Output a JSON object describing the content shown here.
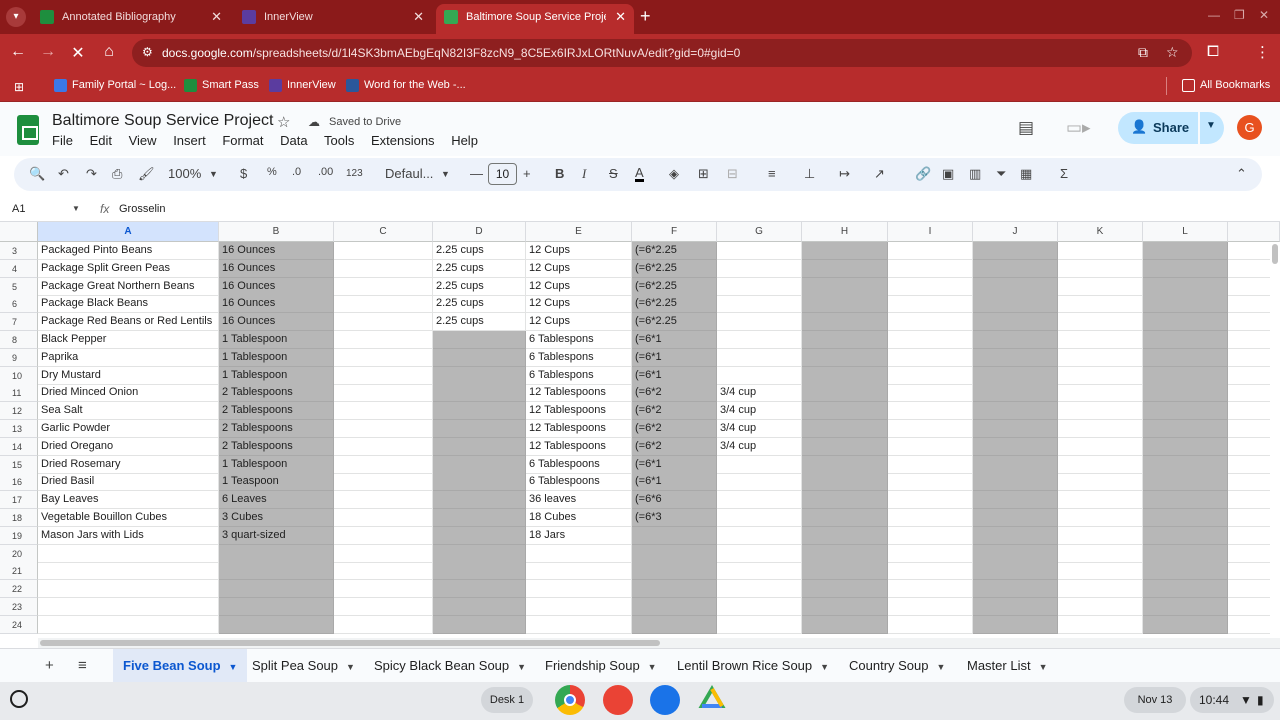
{
  "browser": {
    "tabs": [
      {
        "title": "Annotated Bibliography",
        "icon": "green-sheets-icon",
        "color": "#1e8e3e"
      },
      {
        "title": "InnerView",
        "icon": "innerview-icon",
        "color": "#5b3c9f"
      },
      {
        "title": "Baltimore Soup Service Project",
        "icon": "sheets-icon",
        "color": "#1e8e3e",
        "active": true
      }
    ],
    "url_host": "docs.google.com",
    "url_path": "/spreadsheets/d/1l4SK3bmAEbgEqN82I3F8zcN9_8C5Ex6IRJxLORtNuvA/edit?gid=0#gid=0",
    "bookmarks": [
      "Family Portal ~ Log...",
      "Smart Pass",
      "InnerView",
      "Word for the Web -..."
    ],
    "all_bookmarks": "All Bookmarks"
  },
  "sheet": {
    "title": "Baltimore Soup Service Project",
    "saved_status": "Saved to Drive",
    "menu": [
      "File",
      "Edit",
      "View",
      "Insert",
      "Format",
      "Data",
      "Tools",
      "Extensions",
      "Help"
    ],
    "share_label": "Share",
    "avatar_letter": "G",
    "toolbar": {
      "zoom": "100%",
      "currency": "$",
      "percent": "%",
      "dec_dec": ".0",
      "inc_dec": ".00",
      "number_format": "123",
      "font": "Defaul...",
      "font_size": "10",
      "bold": "B",
      "italic": "I",
      "strike": "S",
      "textcolor": "A"
    },
    "name_box": "A1",
    "formula": "Grosselin",
    "columns": [
      "A",
      "B",
      "C",
      "D",
      "E",
      "F",
      "G",
      "H",
      "I",
      "J",
      "K",
      "L"
    ],
    "rows": [
      {
        "n": "3",
        "a": "Packaged Pinto Beans",
        "b": "16 Ounces",
        "d": "2.25 cups",
        "e": "12 Cups",
        "f": "(=6*2.25",
        "g": ""
      },
      {
        "n": "4",
        "a": "Package Split Green Peas",
        "b": "16 Ounces",
        "d": "2.25 cups",
        "e": "12 Cups",
        "f": "(=6*2.25",
        "g": ""
      },
      {
        "n": "5",
        "a": "Package Great Northern Beans",
        "b": "16 Ounces",
        "d": "2.25 cups",
        "e": "12 Cups",
        "f": "(=6*2.25",
        "g": ""
      },
      {
        "n": "6",
        "a": "Package Black Beans",
        "b": "16 Ounces",
        "d": "2.25 cups",
        "e": "12 Cups",
        "f": "(=6*2.25",
        "g": ""
      },
      {
        "n": "7",
        "a": "Package Red Beans or Red Lentils",
        "b": "16 Ounces",
        "d": "2.25 cups",
        "e": "12 Cups",
        "f": "(=6*2.25",
        "g": ""
      },
      {
        "n": "8",
        "a": "Black Pepper",
        "b": "1 Tablespoon",
        "d": "",
        "e": "6 Tablespons",
        "f": "(=6*1",
        "g": ""
      },
      {
        "n": "9",
        "a": "Paprika",
        "b": "1 Tablespoon",
        "d": "",
        "e": "6 Tablespons",
        "f": "(=6*1",
        "g": ""
      },
      {
        "n": "10",
        "a": "Dry Mustard",
        "b": "1 Tablespoon",
        "d": "",
        "e": "6 Tablespons",
        "f": "(=6*1",
        "g": ""
      },
      {
        "n": "11",
        "a": "Dried Minced Onion",
        "b": "2 Tablespoons",
        "d": "",
        "e": "12 Tablespoons",
        "f": "(=6*2",
        "g": "3/4 cup"
      },
      {
        "n": "12",
        "a": "Sea Salt",
        "b": "2 Tablespoons",
        "d": "",
        "e": "12 Tablespoons",
        "f": "(=6*2",
        "g": "3/4 cup"
      },
      {
        "n": "13",
        "a": "Garlic Powder",
        "b": "2 Tablespoons",
        "d": "",
        "e": "12 Tablespoons",
        "f": "(=6*2",
        "g": "3/4 cup"
      },
      {
        "n": "14",
        "a": "Dried Oregano",
        "b": "2 Tablespoons",
        "d": "",
        "e": "12 Tablespoons",
        "f": "(=6*2",
        "g": "3/4 cup"
      },
      {
        "n": "15",
        "a": "Dried Rosemary",
        "b": "1 Tablespoon",
        "d": "",
        "e": "6 Tablespoons",
        "f": "(=6*1",
        "g": ""
      },
      {
        "n": "16",
        "a": "Dried Basil",
        "b": "1 Teaspoon",
        "d": "",
        "e": "6 Tablespoons",
        "f": "(=6*1",
        "g": ""
      },
      {
        "n": "17",
        "a": "Bay Leaves",
        "b": "6 Leaves",
        "d": "",
        "e": "36 leaves",
        "f": "(=6*6",
        "g": ""
      },
      {
        "n": "18",
        "a": "Vegetable Bouillon Cubes",
        "b": "3 Cubes",
        "d": "",
        "e": "18 Cubes",
        "f": "(=6*3",
        "g": ""
      },
      {
        "n": "19",
        "a": "Mason Jars with Lids",
        "b": "3 quart-sized",
        "d": "",
        "e": "18 Jars",
        "f": "",
        "g": ""
      },
      {
        "n": "20",
        "a": "",
        "b": "",
        "d": "",
        "e": "",
        "f": "",
        "g": ""
      },
      {
        "n": "21",
        "a": "",
        "b": "",
        "d": "",
        "e": "",
        "f": "",
        "g": ""
      },
      {
        "n": "22",
        "a": "",
        "b": "",
        "d": "",
        "e": "",
        "f": "",
        "g": ""
      },
      {
        "n": "23",
        "a": "",
        "b": "",
        "d": "",
        "e": "",
        "f": "",
        "g": ""
      },
      {
        "n": "24",
        "a": "",
        "b": "",
        "d": "",
        "e": "",
        "f": "",
        "g": ""
      }
    ],
    "sheet_tabs": [
      "Five Bean Soup",
      "Split Pea Soup",
      "Spicy Black Bean Soup",
      "Friendship Soup",
      "Lentil Brown Rice Soup",
      "Country Soup",
      "Master List"
    ],
    "active_sheet": "Five Bean Soup"
  },
  "shelf": {
    "desk_label": "Desk 1",
    "date": "Nov 13",
    "time": "10:44"
  },
  "colors": {
    "browser_frame": "#8b1a1a",
    "browser_toolbar": "#b72c2c",
    "gray_fill": "#b7b7b7",
    "accent_blue": "#0b57d0"
  }
}
